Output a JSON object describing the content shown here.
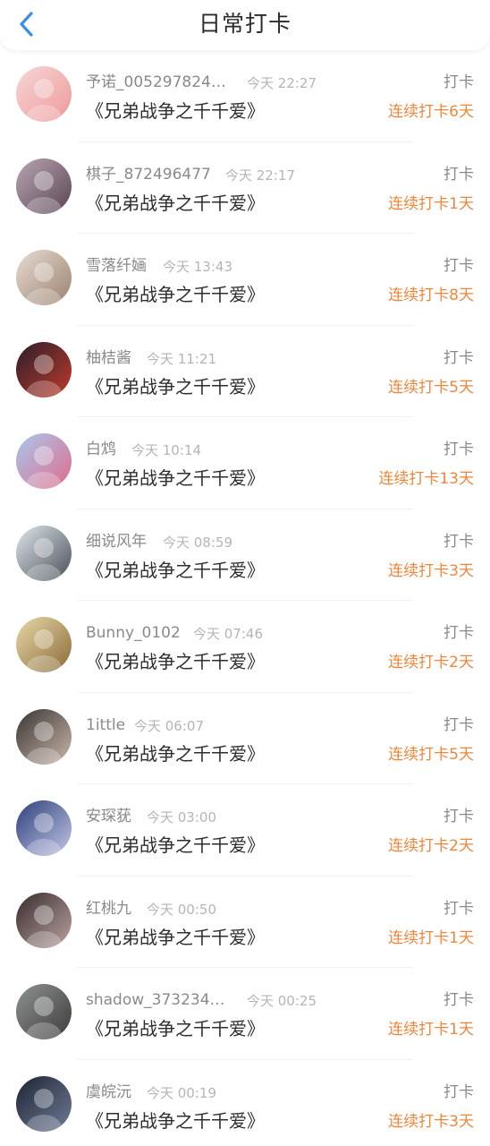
{
  "header": {
    "title": "日常打卡",
    "back_icon": "chevron-left-icon",
    "accent_color": "#3a8ee6"
  },
  "colors": {
    "streak": "#f0863a",
    "username": "#8a8a8a",
    "time": "#b5b5b5",
    "book": "#2e2e2e"
  },
  "items": [
    {
      "username": "予诺_005297824…",
      "time": "今天 22:27",
      "book": "《兄弟战争之千千爱》",
      "action": "打卡",
      "streak": "连续打卡6天",
      "avatar_colors": [
        "#f6d6d6",
        "#ee9a9a"
      ]
    },
    {
      "username": "棋子_872496477",
      "time": "今天 22:17",
      "book": "《兄弟战争之千千爱》",
      "action": "打卡",
      "streak": "连续打卡1天",
      "avatar_colors": [
        "#b9a6b3",
        "#5a4453"
      ]
    },
    {
      "username": "雪落纤婳",
      "time": "今天 13:43",
      "book": "《兄弟战争之千千爱》",
      "action": "打卡",
      "streak": "连续打卡8天",
      "avatar_colors": [
        "#e7ddd2",
        "#9c8170"
      ]
    },
    {
      "username": "柚桔酱",
      "time": "今天 11:21",
      "book": "《兄弟战争之千千爱》",
      "action": "打卡",
      "streak": "连续打卡5天",
      "avatar_colors": [
        "#2a1f2a",
        "#c0392b"
      ]
    },
    {
      "username": "白鸩",
      "time": "今天 10:14",
      "book": "《兄弟战争之千千爱》",
      "action": "打卡",
      "streak": "连续打卡13天",
      "avatar_colors": [
        "#a8c8ee",
        "#e06b8b"
      ]
    },
    {
      "username": "细说风年",
      "time": "今天 08:59",
      "book": "《兄弟战争之千千爱》",
      "action": "打卡",
      "streak": "连续打卡3天",
      "avatar_colors": [
        "#dfe6ec",
        "#4b4f58"
      ]
    },
    {
      "username": "Bunny_0102",
      "time": "今天 07:46",
      "book": "《兄弟战争之千千爱》",
      "action": "打卡",
      "streak": "连续打卡2天",
      "avatar_colors": [
        "#e9d9a8",
        "#8a6a3a"
      ]
    },
    {
      "username": "1ittle",
      "time": "今天 06:07",
      "book": "《兄弟战争之千千爱》",
      "action": "打卡",
      "streak": "连续打卡5天",
      "avatar_colors": [
        "#3a3434",
        "#c9b7a8"
      ]
    },
    {
      "username": "安琛莸",
      "time": "今天 03:00",
      "book": "《兄弟战争之千千爱》",
      "action": "打卡",
      "streak": "连续打卡2天",
      "avatar_colors": [
        "#2d3f7a",
        "#c3c6e6"
      ]
    },
    {
      "username": "红桃九",
      "time": "今天 00:50",
      "book": "《兄弟战争之千千爱》",
      "action": "打卡",
      "streak": "连续打卡1天",
      "avatar_colors": [
        "#3a2b2e",
        "#b9a3a0"
      ]
    },
    {
      "username": "shadow_373234…",
      "time": "今天 00:25",
      "book": "《兄弟战争之千千爱》",
      "action": "打卡",
      "streak": "连续打卡1天",
      "avatar_colors": [
        "#8d9490",
        "#3e3a3b"
      ]
    },
    {
      "username": "虞皖沅",
      "time": "今天 00:19",
      "book": "《兄弟战争之千千爱》",
      "action": "打卡",
      "streak": "连续打卡3天",
      "avatar_colors": [
        "#1e2434",
        "#6e7b96"
      ]
    }
  ]
}
